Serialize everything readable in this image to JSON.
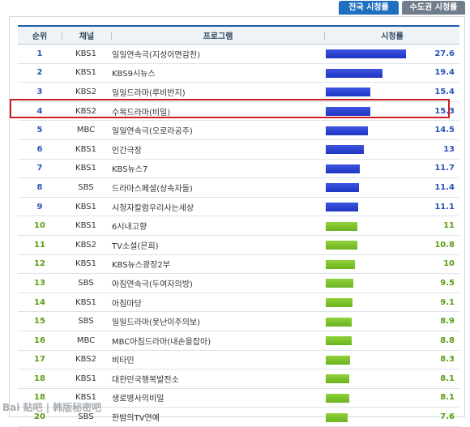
{
  "tabs": [
    {
      "label": "전국 시청률",
      "active": true
    },
    {
      "label": "수도권 시청률",
      "active": false
    }
  ],
  "columns": {
    "rank": "순위",
    "channel": "채널",
    "program": "프로그램",
    "rating": "시청률"
  },
  "rows": [
    {
      "rank": "1",
      "channel": "KBS1",
      "program": "일일연속극(지성이면감천)",
      "rating": "27.6",
      "value": 27.6,
      "color": "blue"
    },
    {
      "rank": "2",
      "channel": "KBS1",
      "program": "KBS9시뉴스",
      "rating": "19.4",
      "value": 19.4,
      "color": "blue"
    },
    {
      "rank": "3",
      "channel": "KBS2",
      "program": "일일드라마(루비반지)",
      "rating": "15.4",
      "value": 15.4,
      "color": "blue"
    },
    {
      "rank": "4",
      "channel": "KBS2",
      "program": "수목드라마(비밀)",
      "rating": "15.3",
      "value": 15.3,
      "color": "blue"
    },
    {
      "rank": "5",
      "channel": "MBC",
      "program": "일일연속극(오로라공주)",
      "rating": "14.5",
      "value": 14.5,
      "color": "blue"
    },
    {
      "rank": "6",
      "channel": "KBS1",
      "program": "인간극장",
      "rating": "13",
      "value": 13,
      "color": "blue"
    },
    {
      "rank": "7",
      "channel": "KBS1",
      "program": "KBS뉴스7",
      "rating": "11.7",
      "value": 11.7,
      "color": "blue"
    },
    {
      "rank": "8",
      "channel": "SBS",
      "program": "드라마스페셜(상속자들)",
      "rating": "11.4",
      "value": 11.4,
      "color": "blue"
    },
    {
      "rank": "9",
      "channel": "KBS1",
      "program": "시청자칼럼우리사는세상",
      "rating": "11.1",
      "value": 11.1,
      "color": "blue"
    },
    {
      "rank": "10",
      "channel": "KBS1",
      "program": "6시내고향",
      "rating": "11",
      "value": 11,
      "color": "green"
    },
    {
      "rank": "11",
      "channel": "KBS2",
      "program": "TV소설(은희)",
      "rating": "10.8",
      "value": 10.8,
      "color": "green"
    },
    {
      "rank": "12",
      "channel": "KBS1",
      "program": "KBS뉴스광장2부",
      "rating": "10",
      "value": 10,
      "color": "green"
    },
    {
      "rank": "13",
      "channel": "SBS",
      "program": "아침연속극(두여자의방)",
      "rating": "9.5",
      "value": 9.5,
      "color": "green"
    },
    {
      "rank": "14",
      "channel": "KBS1",
      "program": "아침마당",
      "rating": "9.1",
      "value": 9.1,
      "color": "green"
    },
    {
      "rank": "15",
      "channel": "SBS",
      "program": "일일드라마(못난이주의보)",
      "rating": "8.9",
      "value": 8.9,
      "color": "green"
    },
    {
      "rank": "16",
      "channel": "MBC",
      "program": "MBC아침드라마(내손을잡아)",
      "rating": "8.8",
      "value": 8.8,
      "color": "green"
    },
    {
      "rank": "17",
      "channel": "KBS2",
      "program": "비타민",
      "rating": "8.3",
      "value": 8.3,
      "color": "green"
    },
    {
      "rank": "18",
      "channel": "KBS1",
      "program": "대한민국행복발전소",
      "rating": "8.1",
      "value": 8.1,
      "color": "green"
    },
    {
      "rank": "18",
      "channel": "KBS1",
      "program": "생로병사의비밀",
      "rating": "8.1",
      "value": 8.1,
      "color": "green"
    },
    {
      "rank": "20",
      "channel": "SBS",
      "program": "한밤의TV연예",
      "rating": "7.6",
      "value": 7.6,
      "color": "green"
    }
  ],
  "highlighted_rank": "4",
  "watermark": "Bai 贴吧 | 韩版秘密吧",
  "colors": {
    "header_blue": "#1e6fbf",
    "bar_blue": "#2d45d6",
    "bar_green": "#7cc22b",
    "highlight": "#cc1f1f"
  }
}
